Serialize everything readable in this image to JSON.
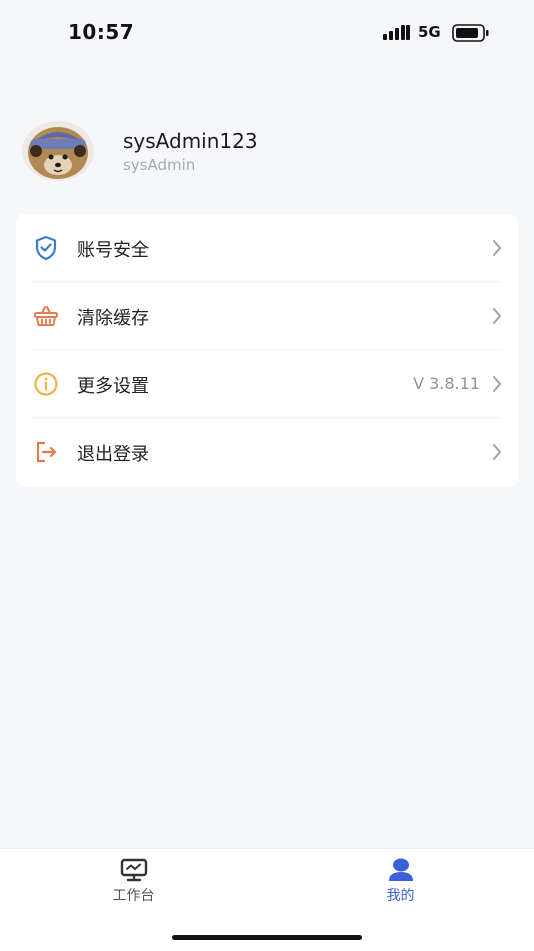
{
  "status_bar": {
    "time": "10:57",
    "network": "5G",
    "signal_icon": "signal-bars-icon",
    "battery_icon": "battery-icon"
  },
  "profile": {
    "username": "sysAdmin123",
    "role": "sysAdmin"
  },
  "menu": {
    "items": [
      {
        "label": "账号安全",
        "icon": "shield-check-icon",
        "icon_color": "#3a7bd5",
        "value": ""
      },
      {
        "label": "清除缓存",
        "icon": "basket-icon",
        "icon_color": "#e27d4f",
        "value": ""
      },
      {
        "label": "更多设置",
        "icon": "info-circle-icon",
        "icon_color": "#e9b44c",
        "value": "V 3.8.11"
      },
      {
        "label": "退出登录",
        "icon": "logout-icon",
        "icon_color": "#e27d4f",
        "value": ""
      }
    ]
  },
  "tab_bar": {
    "tabs": [
      {
        "label": "工作台",
        "icon": "monitor-icon",
        "active": false
      },
      {
        "label": "我的",
        "icon": "user-icon",
        "active": true
      }
    ],
    "active_color": "#3a62d8",
    "inactive_color": "#555555"
  }
}
